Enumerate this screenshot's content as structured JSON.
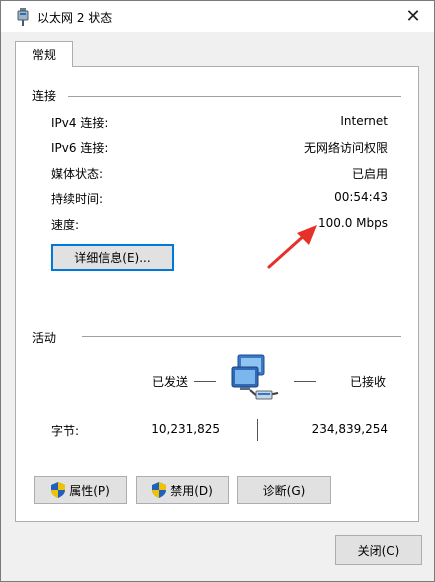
{
  "window": {
    "title": "以太网 2 状态",
    "close_glyph": "✕"
  },
  "tabs": [
    {
      "label": "常规"
    }
  ],
  "connection": {
    "section_label": "连接",
    "rows": [
      {
        "label": "IPv4 连接:",
        "value": "Internet"
      },
      {
        "label": "IPv6 连接:",
        "value": "无网络访问权限"
      },
      {
        "label": "媒体状态:",
        "value": "已启用"
      },
      {
        "label": "持续时间:",
        "value": "00:54:43"
      },
      {
        "label": "速度:",
        "value": "100.0 Mbps"
      }
    ],
    "details_button": "详细信息(E)..."
  },
  "activity": {
    "section_label": "活动",
    "sent_label": "已发送",
    "received_label": "已接收",
    "bytes_label": "字节:",
    "bytes_sent": "10,231,825",
    "bytes_received": "234,839,254"
  },
  "buttons": {
    "properties": "属性(P)",
    "disable": "禁用(D)",
    "diagnose": "诊断(G)",
    "close": "关闭(C)"
  },
  "icons": {
    "title": "network-adapter-icon",
    "network": "network-computers-icon",
    "shield": "uac-shield-icon",
    "annotation": "red-arrow"
  },
  "colors": {
    "focus_border": "#0078d7",
    "annotation_red": "#e8302a",
    "shield_blue": "#1f5fbf",
    "shield_yellow": "#f2c200"
  }
}
